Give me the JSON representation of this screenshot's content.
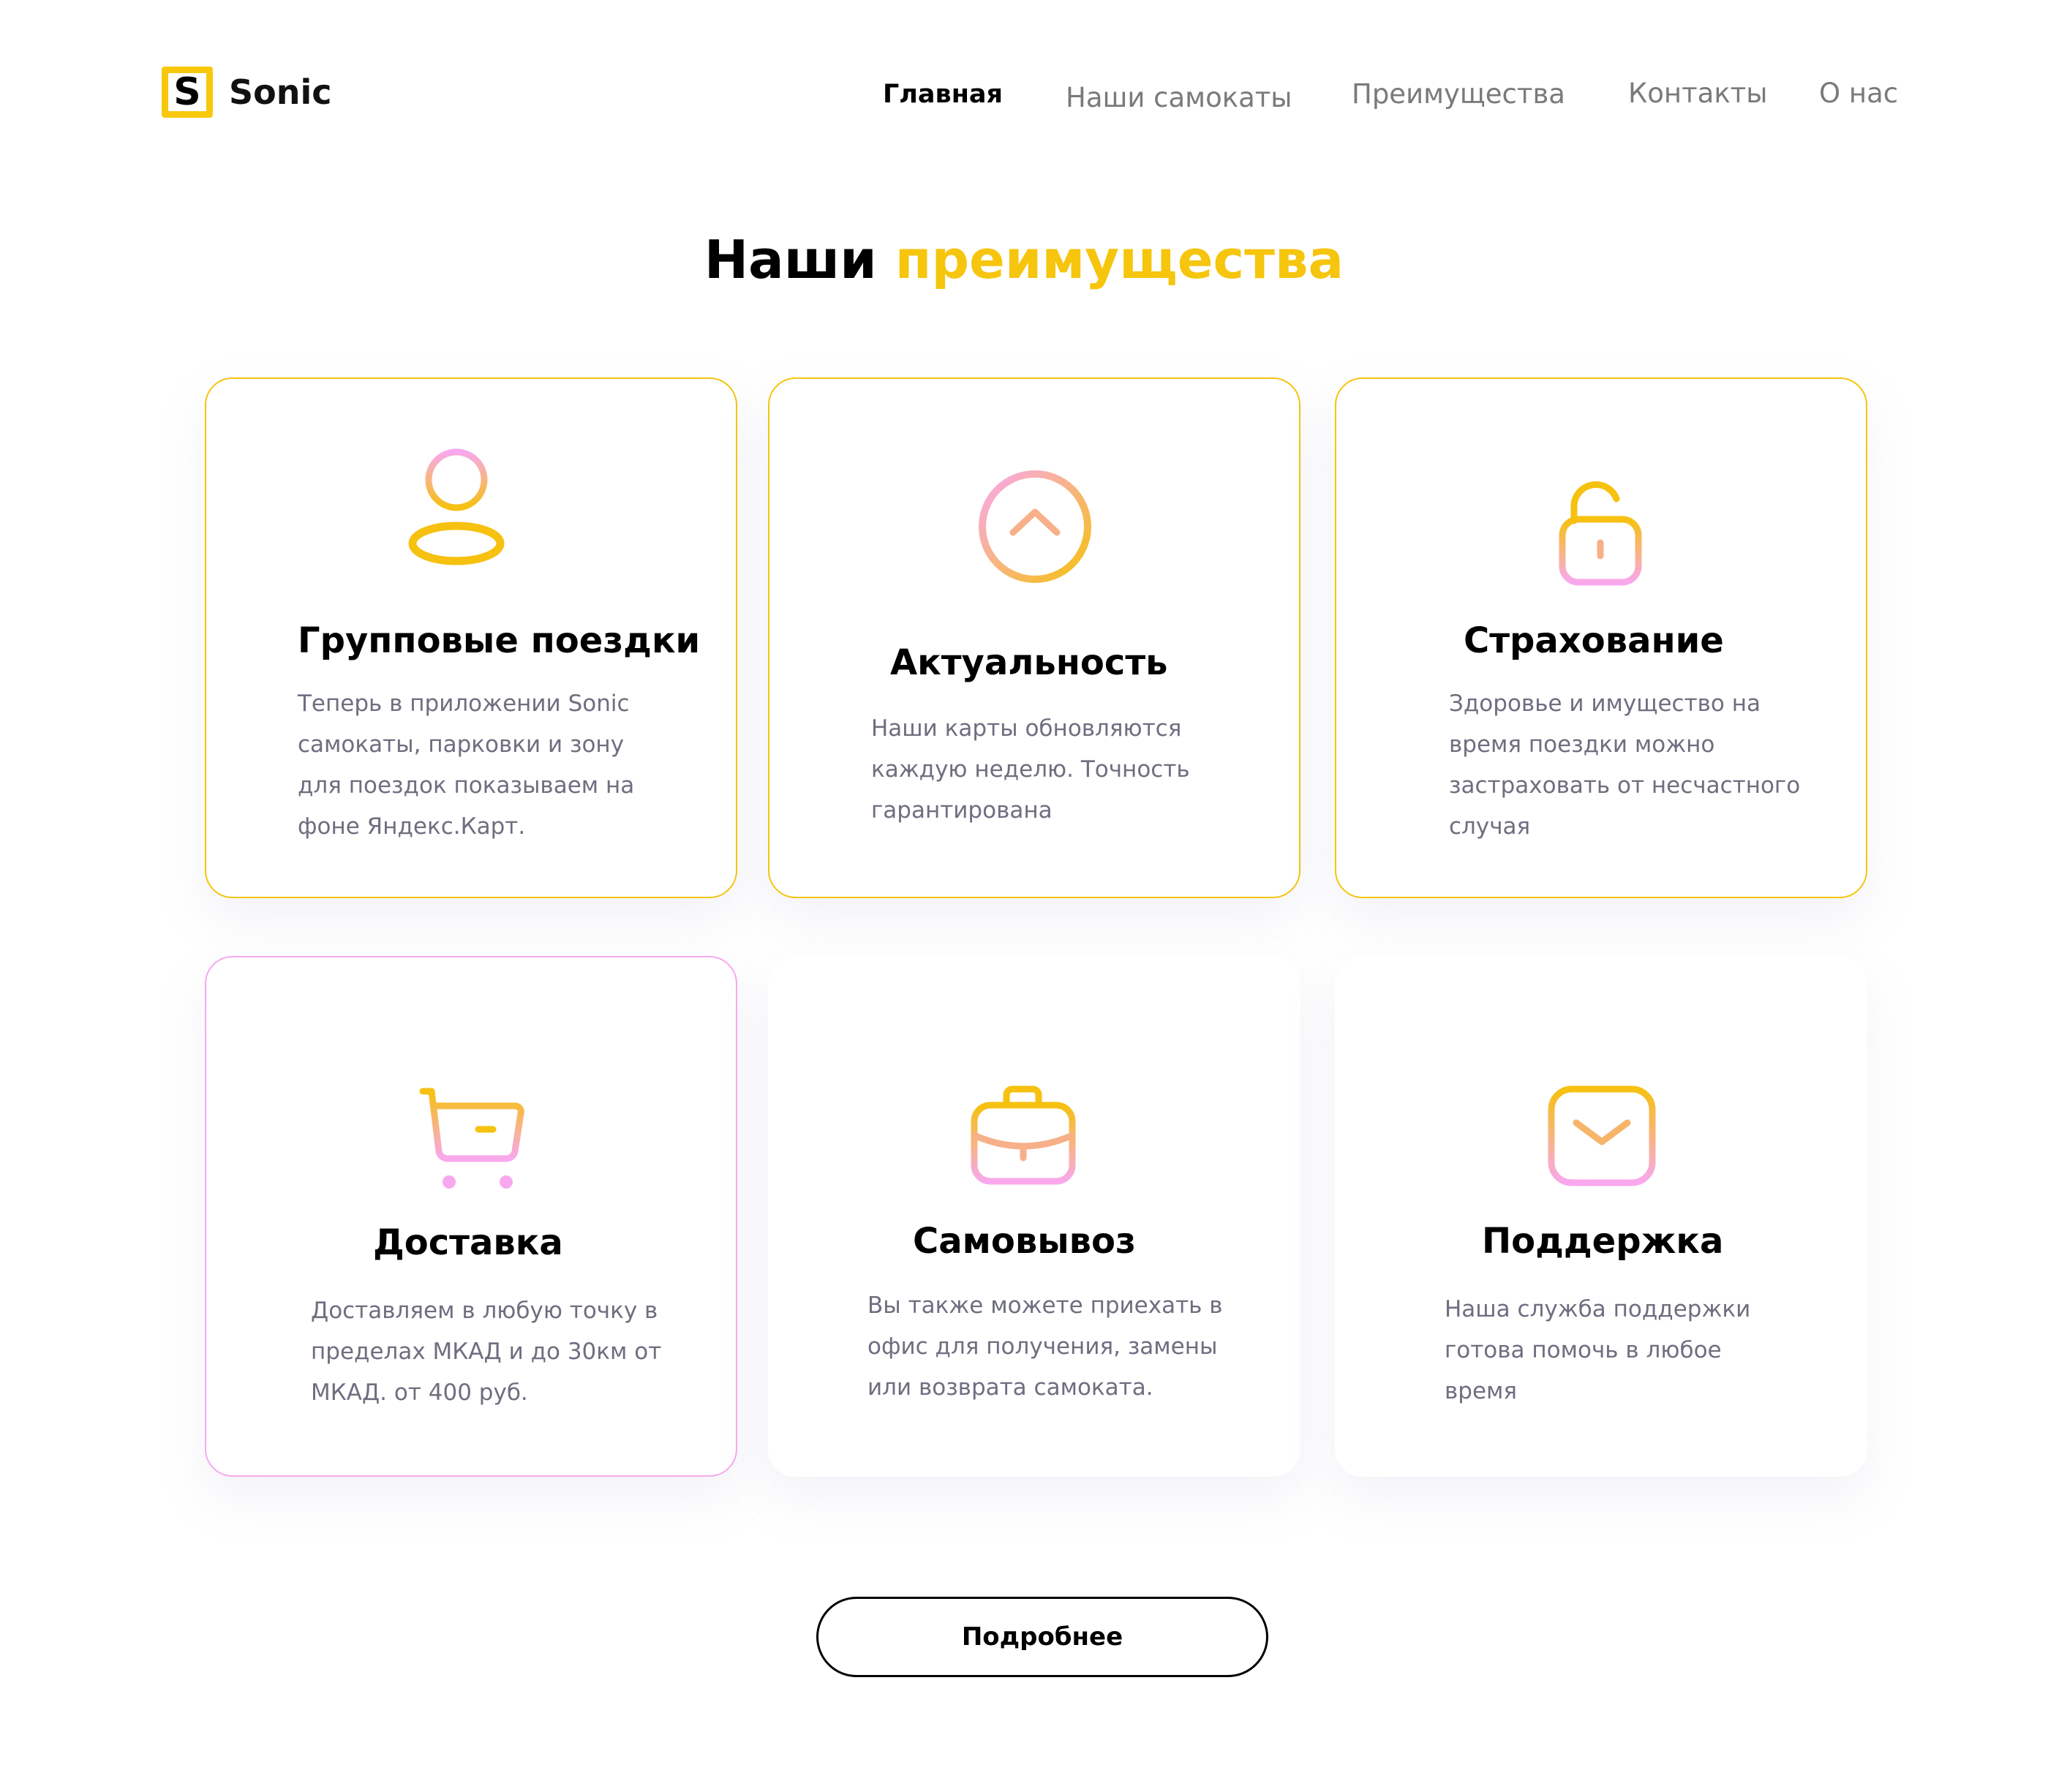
{
  "brand": {
    "logo_letter": "S",
    "name": "Sonic",
    "accent_color": "#F6C50D"
  },
  "nav": {
    "items": [
      {
        "label": "Главная",
        "active": true
      },
      {
        "label": "Наши самокаты",
        "active": false
      },
      {
        "label": "Преимущества",
        "active": false
      },
      {
        "label": "Контакты",
        "active": false
      },
      {
        "label": "О нас",
        "active": false
      }
    ]
  },
  "section": {
    "title_main": "Наши",
    "title_accent": "преимущества"
  },
  "cards": [
    {
      "icon": "user-icon",
      "title": "Групповые поездки",
      "text": "Теперь в приложении  Sonic\nсамокаты, парковки и зону\nдля поездок показываем на\nфоне Яндекс.Карт."
    },
    {
      "icon": "chevron-up-circle-icon",
      "title": "Актуальность",
      "text": "Наши карты обновляются\nкаждую неделю. Точность\nгарантирована"
    },
    {
      "icon": "unlock-icon",
      "title": "Страхование",
      "text": "Здоровье и имущество на\nвремя поездки  можно\nзастраховать от несчастного\nслучая"
    },
    {
      "icon": "cart-icon",
      "title": "Доставка",
      "text": "Доставляем в любую точку в\nпределах МКАД и до 30км от\nМКАД. от 400 руб."
    },
    {
      "icon": "briefcase-icon",
      "title": "Самовывоз",
      "text": "Вы также можете  приехать в\nофис для получения, замены\nили возврата самоката."
    },
    {
      "icon": "mail-icon",
      "title": "Поддержка",
      "text": "Наша служба поддержки\nготова помочь в любое\nвремя"
    }
  ],
  "more_button": {
    "label": "Подробнее"
  }
}
